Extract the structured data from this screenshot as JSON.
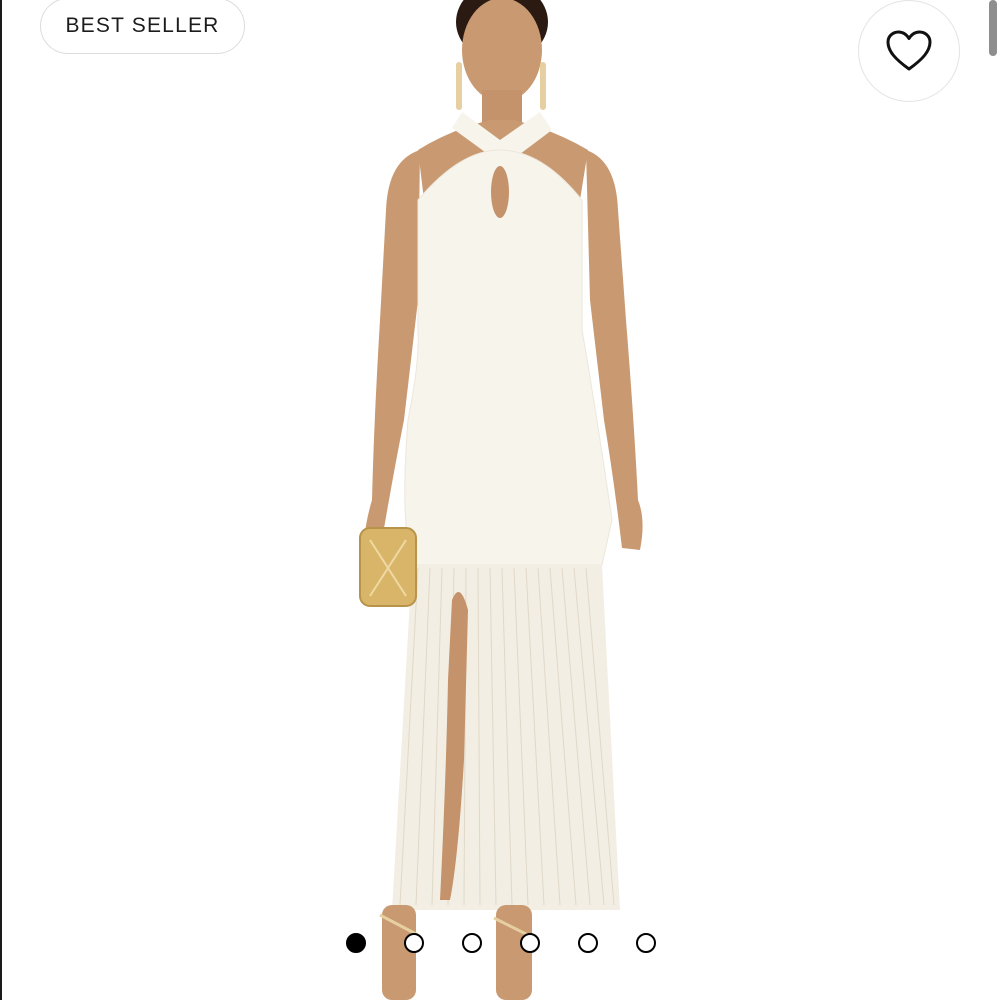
{
  "badge": {
    "label": "BEST SELLER"
  },
  "favorite": {
    "icon": "heart-outline-icon"
  },
  "product_image": {
    "dress_color": "#f7f4ec",
    "skin_color": "#c99a72",
    "clutch_color": "#d9b56a"
  },
  "carousel": {
    "total": 6,
    "active_index": 0
  },
  "colors": {
    "badge_border": "#dcdcdc",
    "text": "#1c1c1c",
    "dot": "#000000"
  }
}
